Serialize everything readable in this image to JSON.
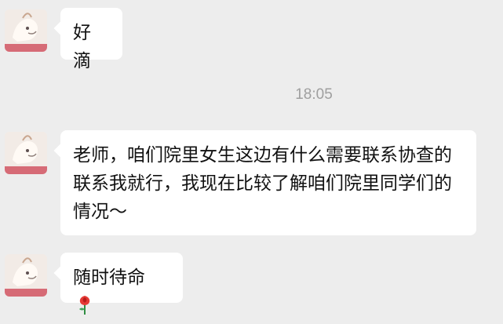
{
  "messages": [
    {
      "text": "好滴"
    },
    {
      "text_lines": [
        "老师，咱们院里女生这边有什么需要联系协查的",
        "联系我就行，我现在比较了解咱们院里同学们的",
        "情况～"
      ]
    },
    {
      "text": "随时待命"
    }
  ],
  "timestamp": "18:05",
  "emoji": "rose-icon"
}
